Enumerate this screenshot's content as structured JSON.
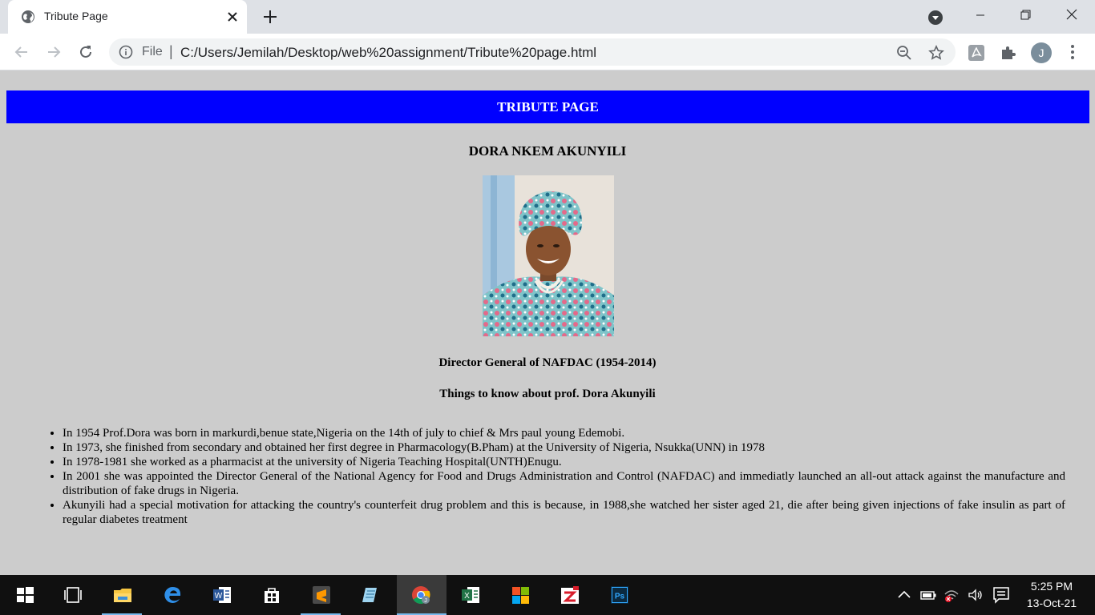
{
  "browser": {
    "tab": {
      "title": "Tribute Page",
      "icon": "globe-icon"
    },
    "omnibox": {
      "scheme_label": "File",
      "separator": "|",
      "url": "C:/Users/Jemilah/Desktop/web%20assignment/Tribute%20page.html"
    },
    "profile_initial": "J"
  },
  "page": {
    "banner": "TRIBUTE PAGE",
    "name": "DORA NKEM AKUNYILI",
    "role": "Director General of NAFDAC (1954-2014)",
    "things_heading": "Things to know about prof. Dora Akunyili",
    "facts": [
      "In 1954 Prof.Dora was born in markurdi,benue state,Nigeria on the 14th of july to chief & Mrs paul young Edemobi.",
      "In 1973, she finished from secondary and obtained her first degree in Pharmacology(B.Pham) at the University of Nigeria, Nsukka(UNN) in 1978",
      "In 1978-1981 she worked as a pharmacist at the university of Nigeria Teaching Hospital(UNTH)Enugu.",
      "In 2001 she was appointed the Director General of the National Agency for Food and Drugs Administration and Control (NAFDAC) and immediatly launched an all-out attack against the manufacture and distribution of fake drugs in Nigeria.",
      "Akunyili had a special motivation for attacking the country's counterfeit drug problem and this is because, in 1988,she watched her sister aged 21, die after being given injections of fake insulin as part of regular diabetes treatment"
    ],
    "colors": {
      "banner_bg": "#0000ff",
      "page_bg": "#cccccc"
    }
  },
  "taskbar": {
    "apps": [
      "start",
      "task-view",
      "file-explorer",
      "edge",
      "word",
      "store",
      "sublime-text",
      "notepad",
      "chrome",
      "excel",
      "office",
      "pdf-reader",
      "photoshop"
    ],
    "clock": {
      "time": "5:25 PM",
      "date": "13-Oct-21"
    }
  }
}
